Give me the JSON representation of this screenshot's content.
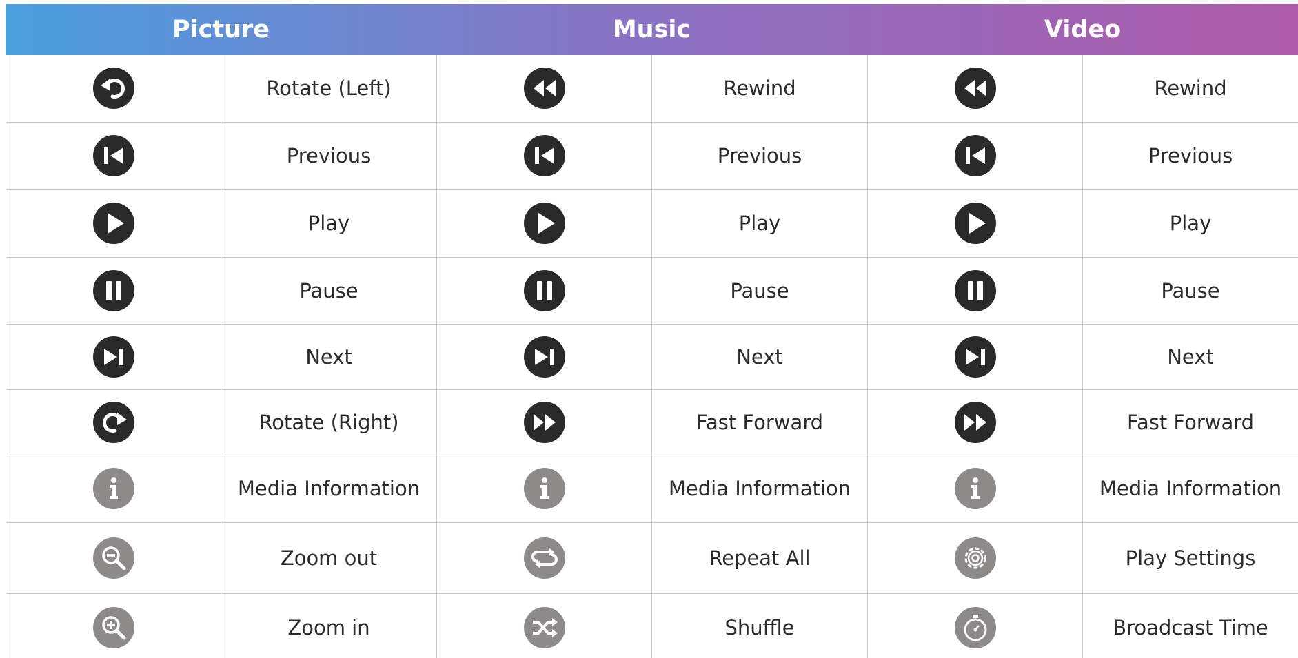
{
  "columns": [
    "Picture",
    "Music",
    "Video"
  ],
  "colors": {
    "dark_icon": "#2a2a2a",
    "grey_icon": "#8e8a8a",
    "header_start": "#4a9fdf",
    "header_end": "#ad5aa9"
  },
  "rows": [
    {
      "height": 97,
      "cells": [
        {
          "icon": "rotate-left-icon",
          "tone": "dark",
          "label": "Rotate (Left)"
        },
        {
          "icon": "rewind-icon",
          "tone": "dark",
          "label": "Rewind"
        },
        {
          "icon": "rewind-icon",
          "tone": "dark",
          "label": "Rewind"
        }
      ]
    },
    {
      "height": 98,
      "cells": [
        {
          "icon": "previous-icon",
          "tone": "dark",
          "label": "Previous"
        },
        {
          "icon": "previous-icon",
          "tone": "dark",
          "label": "Previous"
        },
        {
          "icon": "previous-icon",
          "tone": "dark",
          "label": "Previous"
        }
      ]
    },
    {
      "height": 98,
      "cells": [
        {
          "icon": "play-icon",
          "tone": "dark",
          "label": "Play"
        },
        {
          "icon": "play-icon",
          "tone": "dark",
          "label": "Play"
        },
        {
          "icon": "play-icon",
          "tone": "dark",
          "label": "Play"
        }
      ]
    },
    {
      "height": 97,
      "cells": [
        {
          "icon": "pause-icon",
          "tone": "dark",
          "label": "Pause"
        },
        {
          "icon": "pause-icon",
          "tone": "dark",
          "label": "Pause"
        },
        {
          "icon": "pause-icon",
          "tone": "dark",
          "label": "Pause"
        }
      ]
    },
    {
      "height": 95,
      "cells": [
        {
          "icon": "next-icon",
          "tone": "dark",
          "label": "Next"
        },
        {
          "icon": "next-icon",
          "tone": "dark",
          "label": "Next"
        },
        {
          "icon": "next-icon",
          "tone": "dark",
          "label": "Next"
        }
      ]
    },
    {
      "height": 95,
      "cells": [
        {
          "icon": "rotate-right-icon",
          "tone": "dark",
          "label": "Rotate (Right)"
        },
        {
          "icon": "fast-forward-icon",
          "tone": "dark",
          "label": "Fast Forward"
        },
        {
          "icon": "fast-forward-icon",
          "tone": "dark",
          "label": "Fast Forward"
        }
      ]
    },
    {
      "height": 98,
      "cells": [
        {
          "icon": "info-icon",
          "tone": "grey",
          "label": "Media Information"
        },
        {
          "icon": "info-icon",
          "tone": "grey",
          "label": "Media Information"
        },
        {
          "icon": "info-icon",
          "tone": "grey",
          "label": "Media Information"
        }
      ]
    },
    {
      "height": 103,
      "cells": [
        {
          "icon": "zoom-out-icon",
          "tone": "grey",
          "label": "Zoom out"
        },
        {
          "icon": "repeat-all-icon",
          "tone": "grey",
          "label": "Repeat All"
        },
        {
          "icon": "settings-gear-icon",
          "tone": "grey",
          "label": "Play Settings"
        }
      ]
    },
    {
      "height": 100,
      "cells": [
        {
          "icon": "zoom-in-icon",
          "tone": "grey",
          "label": "Zoom in"
        },
        {
          "icon": "shuffle-icon",
          "tone": "grey",
          "label": "Shuffle"
        },
        {
          "icon": "stopwatch-icon",
          "tone": "grey",
          "label": "Broadcast Time"
        }
      ]
    }
  ]
}
